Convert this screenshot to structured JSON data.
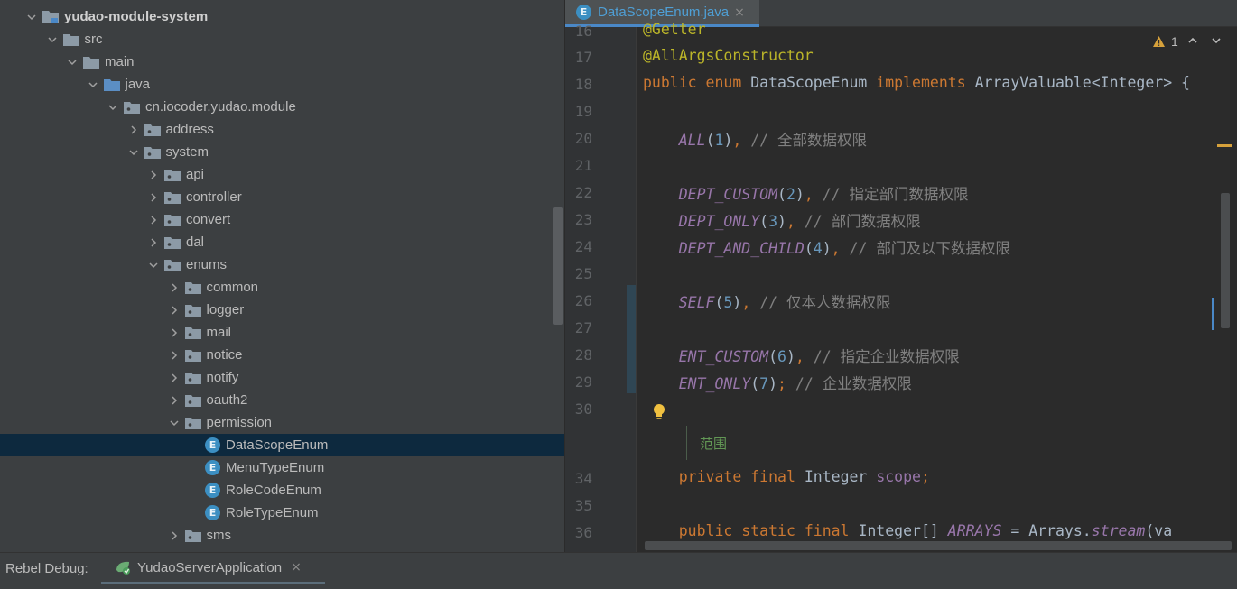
{
  "tree": {
    "items": [
      {
        "label": "yudao-module-system",
        "type": "module",
        "depth": 0,
        "expanded": true
      },
      {
        "label": "src",
        "type": "folder",
        "depth": 1,
        "expanded": true
      },
      {
        "label": "main",
        "type": "folder",
        "depth": 2,
        "expanded": true
      },
      {
        "label": "java",
        "type": "source-folder",
        "depth": 3,
        "expanded": true
      },
      {
        "label": "cn.iocoder.yudao.module",
        "type": "package",
        "depth": 4,
        "expanded": true
      },
      {
        "label": "address",
        "type": "package",
        "depth": 5,
        "expanded": false
      },
      {
        "label": "system",
        "type": "package",
        "depth": 5,
        "expanded": true
      },
      {
        "label": "api",
        "type": "package",
        "depth": 6,
        "expanded": false
      },
      {
        "label": "controller",
        "type": "package",
        "depth": 6,
        "expanded": false
      },
      {
        "label": "convert",
        "type": "package",
        "depth": 6,
        "expanded": false
      },
      {
        "label": "dal",
        "type": "package",
        "depth": 6,
        "expanded": false
      },
      {
        "label": "enums",
        "type": "package",
        "depth": 6,
        "expanded": true
      },
      {
        "label": "common",
        "type": "package",
        "depth": 7,
        "expanded": false
      },
      {
        "label": "logger",
        "type": "package",
        "depth": 7,
        "expanded": false
      },
      {
        "label": "mail",
        "type": "package",
        "depth": 7,
        "expanded": false
      },
      {
        "label": "notice",
        "type": "package",
        "depth": 7,
        "expanded": false
      },
      {
        "label": "notify",
        "type": "package",
        "depth": 7,
        "expanded": false
      },
      {
        "label": "oauth2",
        "type": "package",
        "depth": 7,
        "expanded": false
      },
      {
        "label": "permission",
        "type": "package",
        "depth": 7,
        "expanded": true
      },
      {
        "label": "DataScopeEnum",
        "type": "enum",
        "depth": 8,
        "selected": true
      },
      {
        "label": "MenuTypeEnum",
        "type": "enum",
        "depth": 8
      },
      {
        "label": "RoleCodeEnum",
        "type": "enum",
        "depth": 8
      },
      {
        "label": "RoleTypeEnum",
        "type": "enum",
        "depth": 8
      },
      {
        "label": "sms",
        "type": "package",
        "depth": 7,
        "expanded": false
      }
    ]
  },
  "editor": {
    "tab": {
      "label": "DataScopeEnum.java",
      "icon_letter": "E",
      "close": "×"
    },
    "inspection": {
      "count": "1",
      "up": "⌃",
      "down": "⌄"
    },
    "fold_text": "范围",
    "lines": [
      {
        "n": "16",
        "tokens": [
          {
            "t": "@Getter",
            "c": "ann"
          }
        ]
      },
      {
        "n": "17",
        "tokens": [
          {
            "t": "@AllArgsConstructor",
            "c": "ann"
          }
        ]
      },
      {
        "n": "18",
        "tokens": [
          {
            "t": "public enum ",
            "c": "kw"
          },
          {
            "t": "DataScopeEnum ",
            "c": "ident"
          },
          {
            "t": "implements ",
            "c": "kw"
          },
          {
            "t": "ArrayValuable<Integer>",
            "c": "ident"
          },
          {
            "t": " {",
            "c": "ident"
          }
        ]
      },
      {
        "n": "19",
        "tokens": []
      },
      {
        "n": "20",
        "tokens": [
          {
            "t": "    ",
            "c": "ident"
          },
          {
            "t": "ALL",
            "c": "const"
          },
          {
            "t": "(",
            "c": "ident"
          },
          {
            "t": "1",
            "c": "num"
          },
          {
            "t": ")",
            "c": "ident"
          },
          {
            "t": ", ",
            "c": "kw"
          },
          {
            "t": "// 全部数据权限",
            "c": "cmt"
          }
        ]
      },
      {
        "n": "21",
        "tokens": []
      },
      {
        "n": "22",
        "tokens": [
          {
            "t": "    ",
            "c": "ident"
          },
          {
            "t": "DEPT_CUSTOM",
            "c": "const"
          },
          {
            "t": "(",
            "c": "ident"
          },
          {
            "t": "2",
            "c": "num"
          },
          {
            "t": ")",
            "c": "ident"
          },
          {
            "t": ", ",
            "c": "kw"
          },
          {
            "t": "// 指定部门数据权限",
            "c": "cmt"
          }
        ]
      },
      {
        "n": "23",
        "tokens": [
          {
            "t": "    ",
            "c": "ident"
          },
          {
            "t": "DEPT_ONLY",
            "c": "const"
          },
          {
            "t": "(",
            "c": "ident"
          },
          {
            "t": "3",
            "c": "num"
          },
          {
            "t": ")",
            "c": "ident"
          },
          {
            "t": ", ",
            "c": "kw"
          },
          {
            "t": "// 部门数据权限",
            "c": "cmt"
          }
        ]
      },
      {
        "n": "24",
        "tokens": [
          {
            "t": "    ",
            "c": "ident"
          },
          {
            "t": "DEPT_AND_CHILD",
            "c": "const"
          },
          {
            "t": "(",
            "c": "ident"
          },
          {
            "t": "4",
            "c": "num"
          },
          {
            "t": ")",
            "c": "ident"
          },
          {
            "t": ", ",
            "c": "kw"
          },
          {
            "t": "// 部门及以下数据权限",
            "c": "cmt"
          }
        ]
      },
      {
        "n": "25",
        "tokens": []
      },
      {
        "n": "26",
        "tokens": [
          {
            "t": "    ",
            "c": "ident"
          },
          {
            "t": "SELF",
            "c": "const"
          },
          {
            "t": "(",
            "c": "ident"
          },
          {
            "t": "5",
            "c": "num"
          },
          {
            "t": ")",
            "c": "ident"
          },
          {
            "t": ", ",
            "c": "kw"
          },
          {
            "t": "// 仅本人数据权限",
            "c": "cmt"
          }
        ]
      },
      {
        "n": "27",
        "tokens": []
      },
      {
        "n": "28",
        "tokens": [
          {
            "t": "    ",
            "c": "ident"
          },
          {
            "t": "ENT_CUSTOM",
            "c": "const"
          },
          {
            "t": "(",
            "c": "ident"
          },
          {
            "t": "6",
            "c": "num"
          },
          {
            "t": ")",
            "c": "ident"
          },
          {
            "t": ", ",
            "c": "kw"
          },
          {
            "t": "// 指定企业数据权限",
            "c": "cmt"
          }
        ]
      },
      {
        "n": "29",
        "tokens": [
          {
            "t": "    ",
            "c": "ident"
          },
          {
            "t": "ENT_ONLY",
            "c": "const"
          },
          {
            "t": "(",
            "c": "ident"
          },
          {
            "t": "7",
            "c": "num"
          },
          {
            "t": ")",
            "c": "ident"
          },
          {
            "t": "; ",
            "c": "kw"
          },
          {
            "t": "// 企业数据权限",
            "c": "cmt"
          }
        ]
      },
      {
        "n": "30",
        "tokens": []
      },
      {
        "n": "",
        "tokens": []
      },
      {
        "n": "34",
        "tokens": [
          {
            "t": "    ",
            "c": "ident"
          },
          {
            "t": "private final ",
            "c": "kw"
          },
          {
            "t": "Integer ",
            "c": "ident"
          },
          {
            "t": "scope",
            "c": "field"
          },
          {
            "t": ";",
            "c": "kw"
          }
        ]
      },
      {
        "n": "35",
        "tokens": []
      },
      {
        "n": "36",
        "tokens": [
          {
            "t": "    ",
            "c": "ident"
          },
          {
            "t": "public static final ",
            "c": "kw"
          },
          {
            "t": "Integer[] ",
            "c": "ident"
          },
          {
            "t": "ARRAYS",
            "c": "const"
          },
          {
            "t": " = Arrays.",
            "c": "ident"
          },
          {
            "t": "stream",
            "c": "const"
          },
          {
            "t": "(va",
            "c": "ident"
          }
        ]
      }
    ]
  },
  "bottom": {
    "label": "Rebel Debug:",
    "run_tab": "YudaoServerApplication",
    "close": "×"
  },
  "colors": {
    "accent": "#4a88c7",
    "selection": "#0d293e",
    "warning": "#d6a13b"
  }
}
